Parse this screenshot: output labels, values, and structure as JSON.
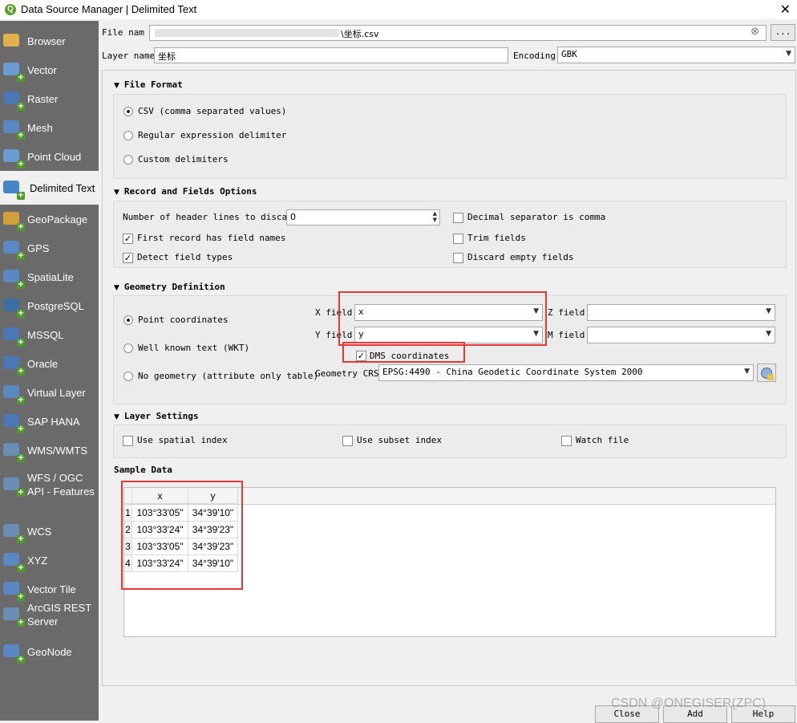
{
  "window": {
    "title": "Data Source Manager | Delimited Text",
    "close_glyph": "✕"
  },
  "sidebar": {
    "items": [
      {
        "label": "Browser",
        "icon": "folder-icon"
      },
      {
        "label": "Vector",
        "icon": "vector-icon"
      },
      {
        "label": "Raster",
        "icon": "raster-icon"
      },
      {
        "label": "Mesh",
        "icon": "mesh-icon"
      },
      {
        "label": "Point Cloud",
        "icon": "point-cloud-icon"
      },
      {
        "label": "Delimited Text",
        "icon": "delimited-text-icon"
      },
      {
        "label": "GeoPackage",
        "icon": "geopackage-icon"
      },
      {
        "label": "GPS",
        "icon": "gps-icon"
      },
      {
        "label": "SpatiaLite",
        "icon": "spatialite-icon"
      },
      {
        "label": "PostgreSQL",
        "icon": "postgresql-icon"
      },
      {
        "label": "MSSQL",
        "icon": "mssql-icon"
      },
      {
        "label": "Oracle",
        "icon": "oracle-icon"
      },
      {
        "label": "Virtual Layer",
        "icon": "virtual-layer-icon"
      },
      {
        "label": "SAP HANA",
        "icon": "sap-hana-icon"
      },
      {
        "label": "WMS/WMTS",
        "icon": "wms-icon"
      },
      {
        "label": "WFS / OGC\nAPI - Features",
        "icon": "wfs-icon"
      },
      {
        "label": "WCS",
        "icon": "wcs-icon"
      },
      {
        "label": "XYZ",
        "icon": "xyz-icon"
      },
      {
        "label": "Vector Tile",
        "icon": "vector-tile-icon"
      },
      {
        "label": "ArcGIS REST\nServer",
        "icon": "arcgis-icon"
      },
      {
        "label": "GeoNode",
        "icon": "geonode-icon"
      }
    ],
    "active": "Delimited Text"
  },
  "file": {
    "label": "File nam",
    "value": "\\坐标.csv",
    "clear_glyph": "⊗",
    "browse_label": "..."
  },
  "layer": {
    "label": "Layer name",
    "value": "坐标",
    "encoding_label": "Encoding",
    "encoding_value": "GBK"
  },
  "file_format": {
    "title": "File Format",
    "options": [
      {
        "label": "CSV (comma separated values)",
        "selected": true
      },
      {
        "label": "Regular expression delimiter",
        "selected": false
      },
      {
        "label": "Custom delimiters",
        "selected": false
      }
    ]
  },
  "record_fields": {
    "title": "Record and Fields Options",
    "header_lines_label": "Number of header lines to discard",
    "header_lines_value": "0",
    "first_record": {
      "label": "First record has field names",
      "checked": true
    },
    "detect_types": {
      "label": "Detect field types",
      "checked": true
    },
    "decimal_comma": {
      "label": "Decimal separator is comma",
      "checked": false
    },
    "trim_fields": {
      "label": "Trim fields",
      "checked": false
    },
    "discard_empty": {
      "label": "Discard empty fields",
      "checked": false
    }
  },
  "geometry": {
    "title": "Geometry Definition",
    "options": [
      {
        "label": "Point coordinates",
        "selected": true
      },
      {
        "label": "Well known text (WKT)",
        "selected": false
      },
      {
        "label": "No geometry (attribute only table)",
        "selected": false
      }
    ],
    "x_label": "X field",
    "x_value": "x",
    "y_label": "Y field",
    "y_value": "y",
    "z_label": "Z field",
    "z_value": "",
    "m_label": "M field",
    "m_value": "",
    "dms": {
      "label": "DMS coordinates",
      "checked": true
    },
    "crs_label": "Geometry CRS",
    "crs_value": "EPSG:4490 - China Geodetic Coordinate System 2000"
  },
  "layer_settings": {
    "title": "Layer Settings",
    "spatial_index": {
      "label": "Use spatial index",
      "checked": false
    },
    "subset_index": {
      "label": "Use subset index",
      "checked": false
    },
    "watch_file": {
      "label": "Watch file",
      "checked": false
    }
  },
  "sample": {
    "title": "Sample Data",
    "columns": [
      "x",
      "y"
    ],
    "rows": [
      {
        "n": "1",
        "x": "103°33'05\"",
        "y": "34°39'10\""
      },
      {
        "n": "2",
        "x": "103°33'24\"",
        "y": "34°39'23\""
      },
      {
        "n": "3",
        "x": "103°33'05\"",
        "y": "34°39'23\""
      },
      {
        "n": "4",
        "x": "103°33'24\"",
        "y": "34°39'10\""
      }
    ]
  },
  "buttons": {
    "close": "Close",
    "add": "Add",
    "help": "Help"
  },
  "watermark": "CSDN @ONEGISER(ZPC)",
  "colors": {
    "sidebar": "#6a6a6a",
    "highlight": "#e53935",
    "accent": "#4f9a2a"
  }
}
